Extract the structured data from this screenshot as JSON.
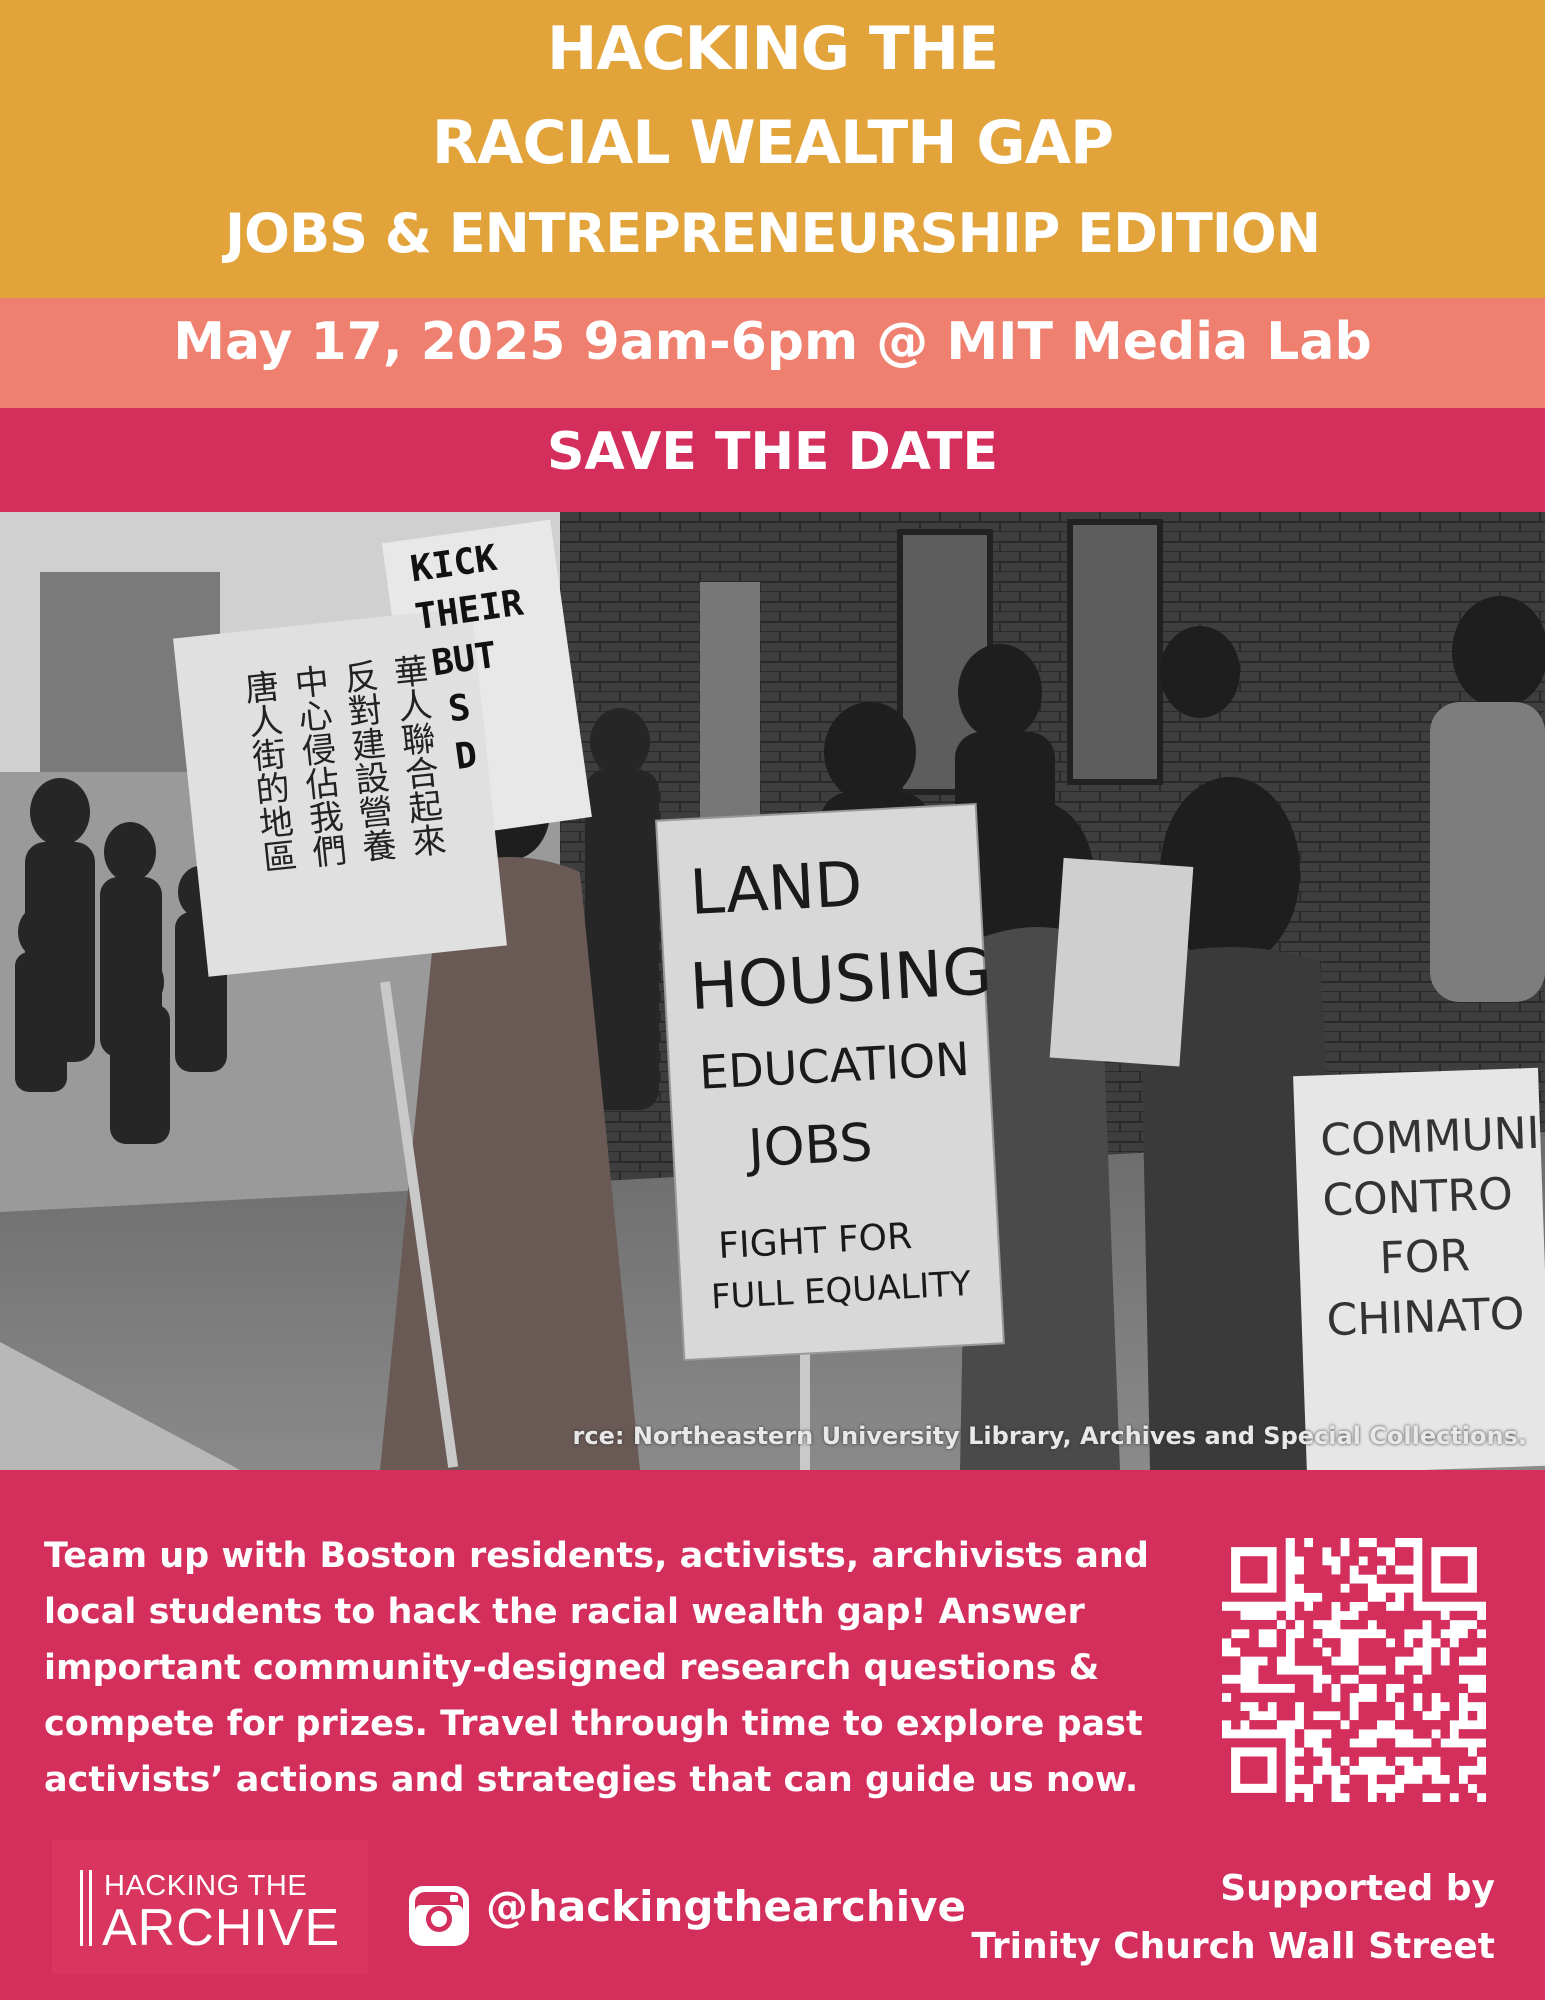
{
  "header": {
    "line1": "HACKING THE",
    "line2": "RACIAL WEALTH GAP",
    "line3": "JOBS & ENTREPRENEURSHIP EDITION"
  },
  "event": {
    "date_line": "May 17, 2025 9am-6pm @ MIT Media Lab",
    "save_the_date": "SAVE THE DATE"
  },
  "photo": {
    "caption": "rce: Northeastern University Library, Archives and Special Collections.",
    "signs": {
      "kick": [
        "KICK",
        "THEIR",
        "BUT",
        "S",
        "D"
      ],
      "chinese": [
        "華人聯合起來",
        "反對建設營養",
        "中心侵佔我們",
        "唐人街的地區"
      ],
      "land": [
        "LAND",
        "HOUSING",
        "EDUCATION",
        "JOBS",
        "FIGHT FOR",
        "FULL EQUALITY"
      ],
      "community": [
        "COMMUNI",
        "CONTRO",
        "FOR",
        "CHINATO"
      ]
    }
  },
  "body_text": "Team up with Boston residents, activists, archivists and local students to hack the racial wealth gap! Answer important community-designed research questions & compete for prizes. Travel through time to explore past activists’ actions and strategies that can guide us now.",
  "footer": {
    "logo_line1": "HACKING THE",
    "logo_line2": "ARCHIVE",
    "instagram_icon": "instagram-icon",
    "handle": "@hackingthearchive",
    "support_line1": "Supported by",
    "support_line2": "Trinity Church Wall Street"
  },
  "colors": {
    "gold": "#e2a33a",
    "salmon": "#ef8070",
    "magenta": "#d42e5c"
  }
}
